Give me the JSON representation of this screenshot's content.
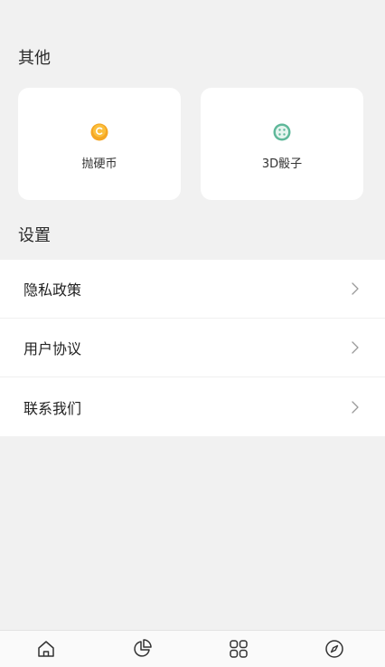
{
  "sections": {
    "other_title": "其他",
    "settings_title": "设置"
  },
  "cards": [
    {
      "label": "抛硬币",
      "icon": "coin-icon"
    },
    {
      "label": "3D骰子",
      "icon": "dice-icon"
    }
  ],
  "settings": {
    "items": [
      {
        "label": "隐私政策"
      },
      {
        "label": "用户协议"
      },
      {
        "label": "联系我们"
      }
    ]
  },
  "tabbar": {
    "items": [
      "home-icon",
      "chart-icon",
      "apps-icon",
      "compass-icon"
    ]
  },
  "colors": {
    "background": "#f1f1f1",
    "coin": "#f5a623",
    "dice": "#5fb89a"
  }
}
